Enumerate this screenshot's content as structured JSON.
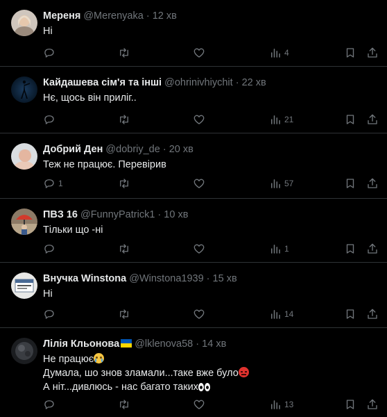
{
  "tweets": [
    {
      "name": "Мереня",
      "handle": "@Merenyaka",
      "dot": "·",
      "time": "12 хв",
      "lines": [
        "Ні"
      ],
      "reply_count": "",
      "views": "4",
      "avatar": "avatar-1"
    },
    {
      "name": "Кайдашева сім'я та інші",
      "handle": "@ohrinivhiychit",
      "dot": "·",
      "time": "22 хв",
      "lines": [
        "Нє, щось він приліг.."
      ],
      "reply_count": "",
      "views": "21",
      "avatar": "avatar-2"
    },
    {
      "name": "Добрий Ден",
      "handle": "@dobriy_de",
      "dot": "·",
      "time": "20 хв",
      "lines": [
        "Теж не працює. Перевірив"
      ],
      "reply_count": "1",
      "views": "57",
      "avatar": "avatar-3"
    },
    {
      "name": "ПВЗ 16",
      "handle": "@FunnyPatrick1",
      "dot": "·",
      "time": "10 хв",
      "lines": [
        "Тільки що -ні"
      ],
      "reply_count": "",
      "views": "1",
      "avatar": "avatar-4"
    },
    {
      "name": "Внучка Winstona",
      "handle": "@Winstona1939",
      "dot": "·",
      "time": "15 хв",
      "lines": [
        "Ні"
      ],
      "reply_count": "",
      "views": "14",
      "avatar": "avatar-5"
    },
    {
      "name": "Лілія Кльонова",
      "handle": "@lklenova58",
      "dot": "·",
      "time": "14 хв",
      "lines": [
        "Не працює",
        "Думала, шо знов зламали...таке вже було",
        "А ніт...дивлюсь - нас багато таких"
      ],
      "reply_count": "",
      "views": "13",
      "avatar": "avatar-6"
    }
  ],
  "icons": {
    "reply": "reply-icon",
    "retweet": "retweet-icon",
    "like": "like-icon",
    "views": "views-icon",
    "bookmark": "bookmark-icon",
    "share": "share-icon"
  },
  "colors": {
    "background": "#000000",
    "text": "#e7e9ea",
    "secondary": "#71767b",
    "divider": "#2f3336"
  }
}
